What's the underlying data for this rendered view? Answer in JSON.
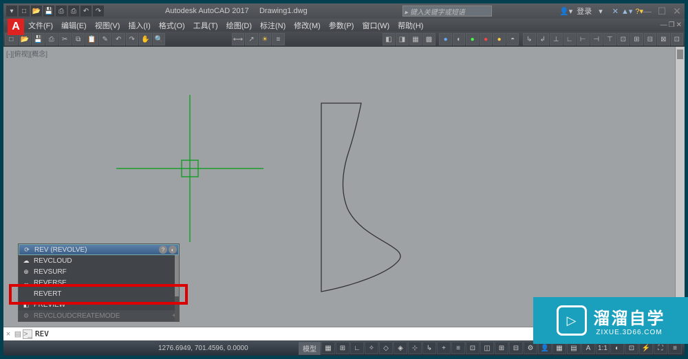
{
  "titlebar": {
    "app_name": "Autodesk AutoCAD 2017",
    "file_name": "Drawing1.dwg",
    "search_placeholder": "键入关键字或短语",
    "login_label": "登录"
  },
  "menubar": {
    "items": [
      "文件(F)",
      "编辑(E)",
      "视图(V)",
      "插入(I)",
      "格式(O)",
      "工具(T)",
      "绘图(D)",
      "标注(N)",
      "修改(M)",
      "参数(P)",
      "窗口(W)",
      "帮助(H)"
    ]
  },
  "viewport": {
    "label": "[-][俯视][概念]"
  },
  "suggestions": {
    "items": [
      {
        "icon": "⟳",
        "text": "REV (REVOLVE)",
        "highlighted": true
      },
      {
        "icon": "☁",
        "text": "REVCLOUD",
        "highlighted": false
      },
      {
        "icon": "⊕",
        "text": "REVSURF",
        "highlighted": false
      },
      {
        "icon": "↔",
        "text": "REVERSE",
        "highlighted": false
      },
      {
        "icon": "",
        "text": "REVERT",
        "highlighted": false
      },
      {
        "icon": "◧",
        "text": "PREVIEW",
        "highlighted": false
      }
    ],
    "sysvar": "REVCLOUDCREATEMODE"
  },
  "command": {
    "prompt": ">_",
    "value": "REV"
  },
  "status": {
    "coords": "1276.6949, 701.4596, 0.0000",
    "model_label": "模型"
  },
  "watermark": {
    "main": "溜溜自学",
    "sub": "ZIXUE.3D66.COM"
  },
  "win_controls": {
    "minimize": "—",
    "maximize": "☐",
    "close": "✕"
  }
}
